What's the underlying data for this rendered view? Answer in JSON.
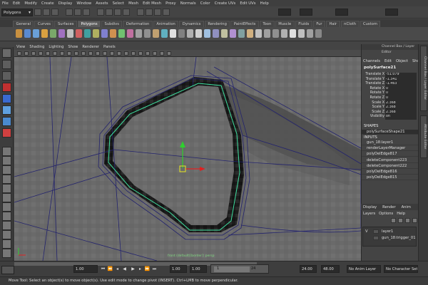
{
  "menus": [
    "File",
    "Edit",
    "Modify",
    "Create",
    "Display",
    "Window",
    "Assets",
    "Select",
    "Mesh",
    "Edit Mesh",
    "Proxy",
    "Normals",
    "Color",
    "Create UVs",
    "Edit UVs",
    "Help"
  ],
  "mode_selector": "Polygons",
  "shelf_tabs": [
    "General",
    "Curves",
    "Surfaces",
    "Polygons",
    "Subdivs",
    "Deformation",
    "Animation",
    "Dynamics",
    "Rendering",
    "PaintEffects",
    "Toon",
    "Muscle",
    "Fluids",
    "Fur",
    "Hair",
    "nCloth",
    "Custom"
  ],
  "shelf_active": "Polygons",
  "viewport_menu": [
    "View",
    "Shading",
    "Lighting",
    "Show",
    "Renderer",
    "Panels"
  ],
  "camera_label": "front (default)[border]: persp",
  "channel_box": {
    "title": "Channel Box / Layer Editor",
    "menu": [
      "Channels",
      "Edit",
      "Object",
      "Show"
    ],
    "object_name": "polySurface21",
    "attributes": [
      {
        "name": "Translate X",
        "value": "-51.079"
      },
      {
        "name": "Translate Y",
        "value": "-1.341"
      },
      {
        "name": "Translate Z",
        "value": "-1.463"
      },
      {
        "name": "Rotate X",
        "value": "0"
      },
      {
        "name": "Rotate Y",
        "value": "0"
      },
      {
        "name": "Rotate Z",
        "value": "0"
      },
      {
        "name": "Scale X",
        "value": "2.368"
      },
      {
        "name": "Scale Y",
        "value": "2.368"
      },
      {
        "name": "Scale Z",
        "value": "2.368"
      },
      {
        "name": "Visibility",
        "value": "on"
      }
    ],
    "shapes_label": "SHAPES",
    "shape_name": "polySurfaceShape21",
    "inputs_label": "INPUTS",
    "inputs": [
      "gun_18:layer1",
      "renderLayerManager",
      "polyDelEdge817",
      "deleteComponent223",
      "deleteComponent222",
      "polyDelEdge816",
      "polyDelEdge815"
    ]
  },
  "side_tabs": [
    "Channel Box / Layer Editor",
    "Attribute Editor"
  ],
  "layer_editor": {
    "tabs": [
      "Display",
      "Render",
      "Anim"
    ],
    "menu": [
      "Layers",
      "Options",
      "Help"
    ],
    "layers": [
      {
        "visible": "V",
        "name": "layer1"
      },
      {
        "visible": "",
        "name": "gun_18:trigger_01"
      }
    ]
  },
  "timeline": {
    "start_time": "1.00",
    "current_start": "1.00",
    "range_start": "1.00",
    "range_start_label": "1",
    "range_end_label": "24",
    "range_end": "24.00",
    "end_time": "48.00",
    "anim_layer": "No Anim Layer",
    "character_set": "No Character Set",
    "current_frame": "1.00"
  },
  "help_line": "Move Tool: Select an object(s) to move object(s). Use edit mode to change pivot (INSERT). Ctrl+LMB to move perpendicular.",
  "colors": {
    "selection_wire": "#3fe0a0",
    "unselected_wire": "#23236e",
    "manipulator_y": "#2fd02f",
    "manipulator_x": "#e02020",
    "manipulator_center": "#e8e820"
  }
}
